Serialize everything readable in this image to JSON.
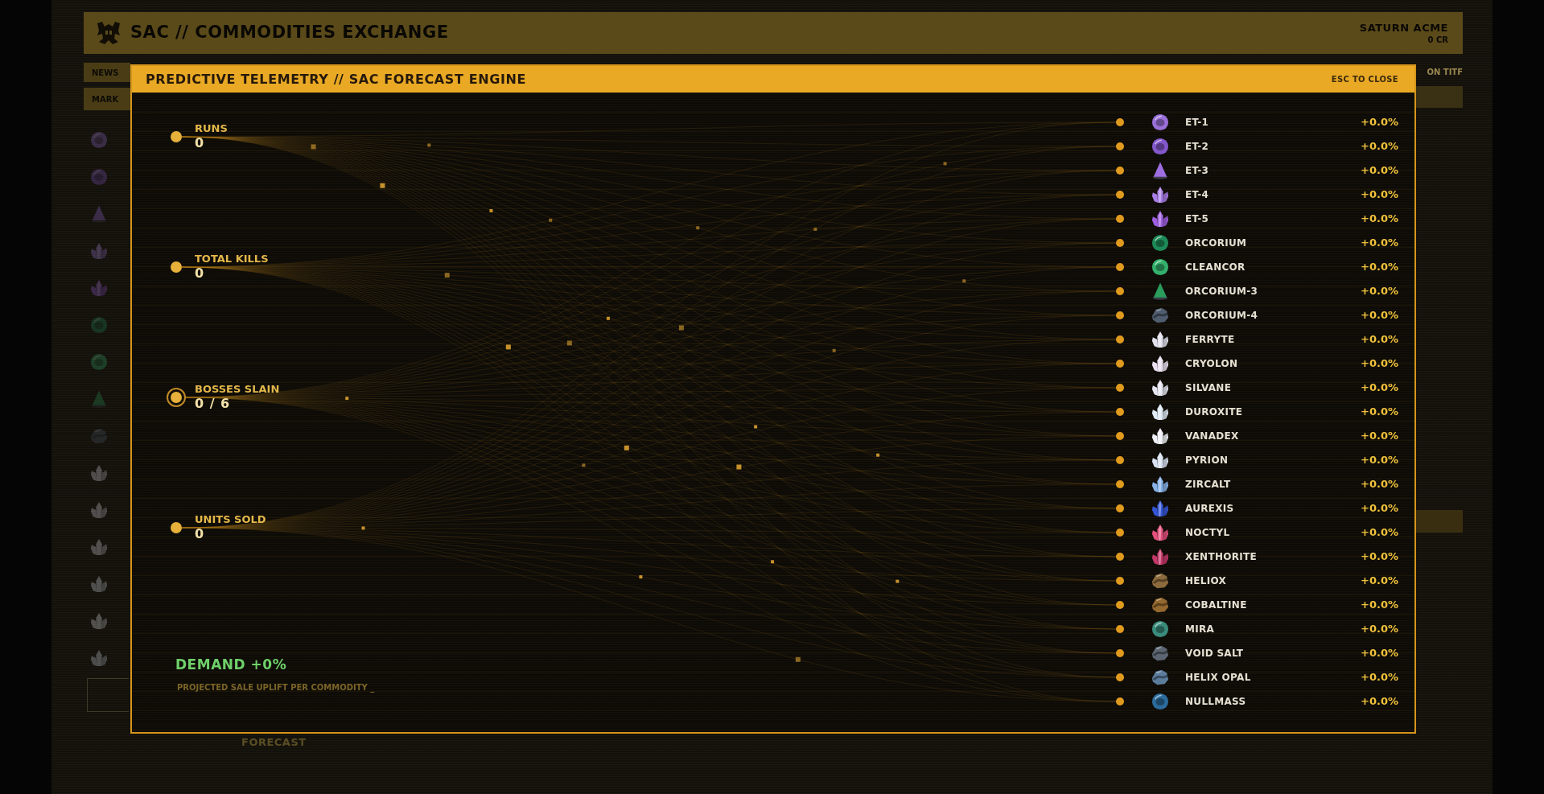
{
  "app_header": {
    "title": "SAC // COMMODITIES EXCHANGE",
    "company": "SATURN ACME",
    "credits": "0 CR"
  },
  "background": {
    "side_tabs": [
      "NEWS",
      "MARK"
    ],
    "side_label": "ON TITF",
    "footer_label": "FORECAST"
  },
  "modal": {
    "title": "PREDICTIVE TELEMETRY // SAC FORECAST ENGINE",
    "close_hint": "ESC TO CLOSE",
    "stats": [
      {
        "label": "RUNS",
        "value": "0",
        "highlighted": false
      },
      {
        "label": "TOTAL KILLS",
        "value": "0",
        "highlighted": false
      },
      {
        "label": "BOSSES SLAIN",
        "value": "0 / 6",
        "highlighted": true
      },
      {
        "label": "UNITS SOLD",
        "value": "0",
        "highlighted": false
      }
    ],
    "demand": {
      "headline": "DEMAND +0%",
      "caption": "PROJECTED SALE UPLIFT PER COMMODITY _"
    },
    "commodities": [
      {
        "name": "ET-1",
        "change": "+0.0%",
        "kind": "geode",
        "color": "#9a70d8"
      },
      {
        "name": "ET-2",
        "change": "+0.0%",
        "kind": "geode",
        "color": "#8458cc"
      },
      {
        "name": "ET-3",
        "change": "+0.0%",
        "kind": "spire",
        "color": "#9d6ee0"
      },
      {
        "name": "ET-4",
        "change": "+0.0%",
        "kind": "crystal",
        "color": "#a87ee6"
      },
      {
        "name": "ET-5",
        "change": "+0.0%",
        "kind": "crystal",
        "color": "#9f5fe0"
      },
      {
        "name": "ORCORIUM",
        "change": "+0.0%",
        "kind": "geode",
        "color": "#1e8a58"
      },
      {
        "name": "CLEANCOR",
        "change": "+0.0%",
        "kind": "geode",
        "color": "#33b06c"
      },
      {
        "name": "ORCORIUM-3",
        "change": "+0.0%",
        "kind": "spire",
        "color": "#2a9c5c"
      },
      {
        "name": "ORCORIUM-4",
        "change": "+0.0%",
        "kind": "rock",
        "color": "#4f5d6e"
      },
      {
        "name": "FERRYTE",
        "change": "+0.0%",
        "kind": "crystal",
        "color": "#e2e2ee"
      },
      {
        "name": "CRYOLON",
        "change": "+0.0%",
        "kind": "crystal",
        "color": "#eadff0"
      },
      {
        "name": "SILVANE",
        "change": "+0.0%",
        "kind": "crystal",
        "color": "#e6e6f2"
      },
      {
        "name": "DUROXITE",
        "change": "+0.0%",
        "kind": "crystal",
        "color": "#dfeaf6"
      },
      {
        "name": "VANADEX",
        "change": "+0.0%",
        "kind": "crystal",
        "color": "#eef0f6"
      },
      {
        "name": "PYRION",
        "change": "+0.0%",
        "kind": "crystal",
        "color": "#d8e2f2"
      },
      {
        "name": "ZIRCALT",
        "change": "+0.0%",
        "kind": "crystal",
        "color": "#86b2e8"
      },
      {
        "name": "AUREXIS",
        "change": "+0.0%",
        "kind": "crystal",
        "color": "#3556d4"
      },
      {
        "name": "NOCTYL",
        "change": "+0.0%",
        "kind": "crystal",
        "color": "#e2507e"
      },
      {
        "name": "XENTHORITE",
        "change": "+0.0%",
        "kind": "crystal",
        "color": "#c23868"
      },
      {
        "name": "HELIOX",
        "change": "+0.0%",
        "kind": "rock",
        "color": "#8c6a3c"
      },
      {
        "name": "COBALTINE",
        "change": "+0.0%",
        "kind": "rock",
        "color": "#94682e"
      },
      {
        "name": "MIRA",
        "change": "+0.0%",
        "kind": "geode",
        "color": "#3a8c7c"
      },
      {
        "name": "VOID SALT",
        "change": "+0.0%",
        "kind": "rock",
        "color": "#5c6672"
      },
      {
        "name": "HELIX OPAL",
        "change": "+0.0%",
        "kind": "rock",
        "color": "#5c7c9c"
      },
      {
        "name": "NULLMASS",
        "change": "+0.0%",
        "kind": "geode",
        "color": "#2c6c9c"
      }
    ]
  }
}
